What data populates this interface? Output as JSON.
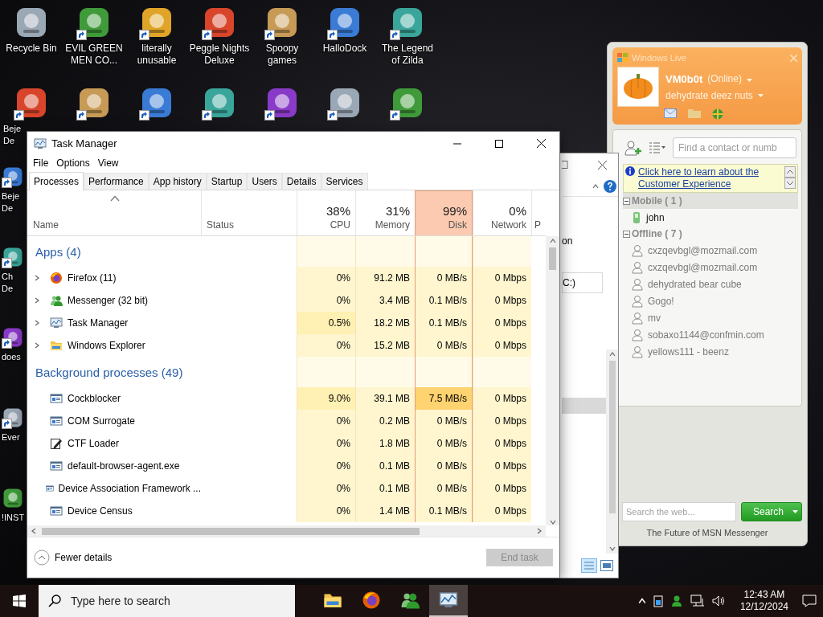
{
  "desktop": {
    "top_row": [
      {
        "label": "Recycle Bin",
        "shortcut": false
      },
      {
        "label": "EVIL GREEN MEN CO...",
        "shortcut": true
      },
      {
        "label": "literally unusable",
        "shortcut": true
      },
      {
        "label": "Peggle Nights Deluxe",
        "shortcut": true
      },
      {
        "label": "Spoopy games",
        "shortcut": true
      },
      {
        "label": "HalloDock",
        "shortcut": true
      },
      {
        "label": "The Legend of Zilda",
        "shortcut": true
      }
    ],
    "second_row": [
      {
        "label": "Beje De",
        "shortcut": true
      },
      {
        "shortcut": true
      },
      {
        "shortcut": true
      },
      {
        "shortcut": true
      },
      {
        "shortcut": true
      },
      {
        "shortcut": true
      },
      {
        "shortcut": true
      }
    ],
    "left_column": [
      {
        "label": "Beje De",
        "shortcut": true
      },
      {
        "label": "Ch De",
        "shortcut": true
      },
      {
        "label": "does",
        "shortcut": true
      },
      {
        "label": "Ever",
        "shortcut": true
      },
      {
        "label": "!INST",
        "shortcut": false
      }
    ]
  },
  "task_manager": {
    "title": "Task Manager",
    "menu": [
      "File",
      "Options",
      "View"
    ],
    "tabs": [
      {
        "label": "Processes",
        "selected": true
      },
      {
        "label": "Performance",
        "selected": false
      },
      {
        "label": "App history",
        "selected": false
      },
      {
        "label": "Startup",
        "selected": false
      },
      {
        "label": "Users",
        "selected": false
      },
      {
        "label": "Details",
        "selected": false
      },
      {
        "label": "Services",
        "selected": false
      }
    ],
    "columns": [
      {
        "label": "Name",
        "sorted": true
      },
      {
        "label": "Status",
        "sorted": false
      },
      {
        "label": "CPU",
        "usage": "38%",
        "hot": false,
        "sorted": false
      },
      {
        "label": "Memory",
        "usage": "31%",
        "hot": false,
        "sorted": false
      },
      {
        "label": "Disk",
        "usage": "99%",
        "hot": true,
        "sorted": false
      },
      {
        "label": "Network",
        "usage": "0%",
        "hot": false,
        "sorted": false
      },
      {
        "label": "P",
        "sorted": false
      }
    ],
    "groups": [
      {
        "title": "Apps (4)",
        "rows": [
          {
            "name": "Firefox (11)",
            "kind": "firefox",
            "expandable": true,
            "cpu": "0%",
            "memory": "91.2 MB",
            "disk": "0 MB/s",
            "network": "0 Mbps",
            "cpu_busy": false,
            "disk_busy": false
          },
          {
            "name": "Messenger (32 bit)",
            "kind": "messenger",
            "expandable": true,
            "cpu": "0%",
            "memory": "3.4 MB",
            "disk": "0.1 MB/s",
            "network": "0 Mbps",
            "cpu_busy": false,
            "disk_busy": false
          },
          {
            "name": "Task Manager",
            "kind": "taskmanager",
            "expandable": true,
            "cpu": "0.5%",
            "memory": "18.2 MB",
            "disk": "0.1 MB/s",
            "network": "0 Mbps",
            "cpu_busy": true,
            "disk_busy": false
          },
          {
            "name": "Windows Explorer",
            "kind": "explorer",
            "expandable": true,
            "cpu": "0%",
            "memory": "15.2 MB",
            "disk": "0 MB/s",
            "network": "0 Mbps",
            "cpu_busy": false,
            "disk_busy": false
          }
        ]
      },
      {
        "title": "Background processes (49)",
        "rows": [
          {
            "name": "Cockblocker",
            "kind": "service",
            "expandable": false,
            "cpu": "9.0%",
            "memory": "39.1 MB",
            "disk": "7.5 MB/s",
            "network": "0 Mbps",
            "cpu_busy": true,
            "disk_busy": true
          },
          {
            "name": "COM Surrogate",
            "kind": "service",
            "expandable": false,
            "cpu": "0%",
            "memory": "0.2 MB",
            "disk": "0 MB/s",
            "network": "0 Mbps",
            "cpu_busy": false,
            "disk_busy": false
          },
          {
            "name": "CTF Loader",
            "kind": "loader",
            "expandable": false,
            "cpu": "0%",
            "memory": "1.8 MB",
            "disk": "0 MB/s",
            "network": "0 Mbps",
            "cpu_busy": false,
            "disk_busy": false
          },
          {
            "name": "default-browser-agent.exe",
            "kind": "service",
            "expandable": false,
            "cpu": "0%",
            "memory": "0.1 MB",
            "disk": "0 MB/s",
            "network": "0 Mbps",
            "cpu_busy": false,
            "disk_busy": false
          },
          {
            "name": "Device Association Framework ...",
            "kind": "service",
            "expandable": false,
            "cpu": "0%",
            "memory": "0.1 MB",
            "disk": "0 MB/s",
            "network": "0 Mbps",
            "cpu_busy": false,
            "disk_busy": false
          },
          {
            "name": "Device Census",
            "kind": "service",
            "expandable": false,
            "cpu": "0%",
            "memory": "1.4 MB",
            "disk": "0.1 MB/s",
            "network": "0 Mbps",
            "cpu_busy": false,
            "disk_busy": false
          }
        ]
      }
    ],
    "footer": {
      "toggle": "Fewer details",
      "end_task": {
        "label": "End task",
        "disabled": true
      }
    }
  },
  "background_window": {
    "partial_label": "on",
    "address_field": "C:)"
  },
  "messenger": {
    "title": "Windows Live",
    "display_name": "VM0b0t",
    "status": "(Online)",
    "personal_message": "dehydrate deez nuts",
    "contact_search": {
      "placeholder": "Find a contact or numb"
    },
    "banner": "Click here to learn about the Customer Experience",
    "groups": [
      {
        "title": "Mobile ( 1 )",
        "expanded": true,
        "contacts": [
          {
            "name": "john",
            "kind": "mobile"
          }
        ]
      },
      {
        "title": "Offline ( 7 )",
        "expanded": true,
        "contacts": [
          {
            "name": "cxzqevbgl@mozmail.com",
            "kind": "offline"
          },
          {
            "name": "cxzqevbgl@mozmail.com",
            "kind": "offline"
          },
          {
            "name": "dehydrated bear cube",
            "kind": "offline"
          },
          {
            "name": "Gogo!",
            "kind": "offline"
          },
          {
            "name": "mv",
            "kind": "offline"
          },
          {
            "name": "sobaxo1144@confmin.com",
            "kind": "offline"
          },
          {
            "name": "yellows111 - beenz",
            "kind": "offline"
          }
        ]
      }
    ],
    "web_search": {
      "placeholder": "Search the web...",
      "button": "Search"
    },
    "footer": "The Future of MSN Messenger"
  },
  "taskbar": {
    "search": {
      "placeholder": "Type here to search"
    },
    "apps": [
      {
        "kind": "explorer",
        "selected": false
      },
      {
        "kind": "firefox",
        "selected": false
      },
      {
        "kind": "messenger",
        "selected": false
      },
      {
        "kind": "taskmanager",
        "selected": true
      }
    ],
    "time": "12:43 AM",
    "date": "12/12/2024"
  }
}
